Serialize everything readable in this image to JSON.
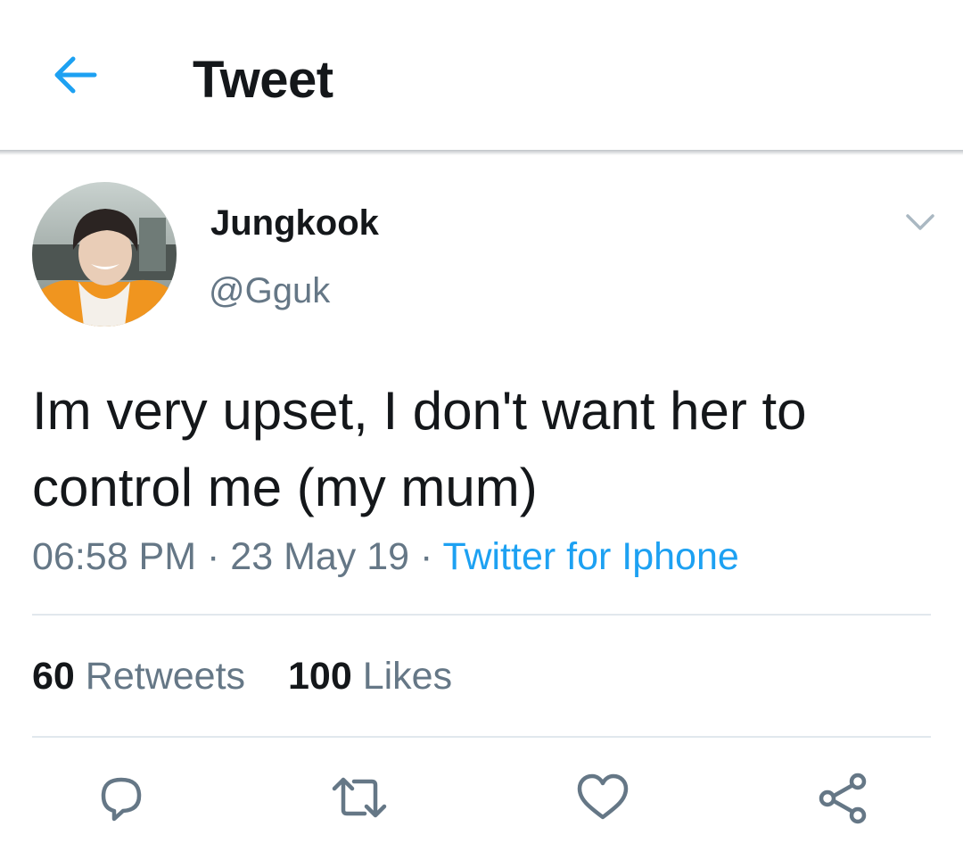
{
  "header": {
    "title": "Tweet",
    "back_icon": "arrow-left-icon"
  },
  "colors": {
    "accent": "#1da1f2",
    "text": "#14171a",
    "secondary": "#657786",
    "divider": "#e1e8ed"
  },
  "tweet": {
    "author_name": "Jungkook",
    "author_handle": "@Gguk",
    "text": "Im very upset, I don't want her to control me (my mum)",
    "time": "06:58 PM",
    "date": "23 May 19",
    "separator": "·",
    "source": "Twitter for Iphone",
    "retweet_count": "60",
    "retweet_label": "Retweets",
    "like_count": "100",
    "like_label": "Likes"
  },
  "actions": [
    "reply-icon",
    "retweet-icon",
    "like-icon",
    "share-icon"
  ]
}
